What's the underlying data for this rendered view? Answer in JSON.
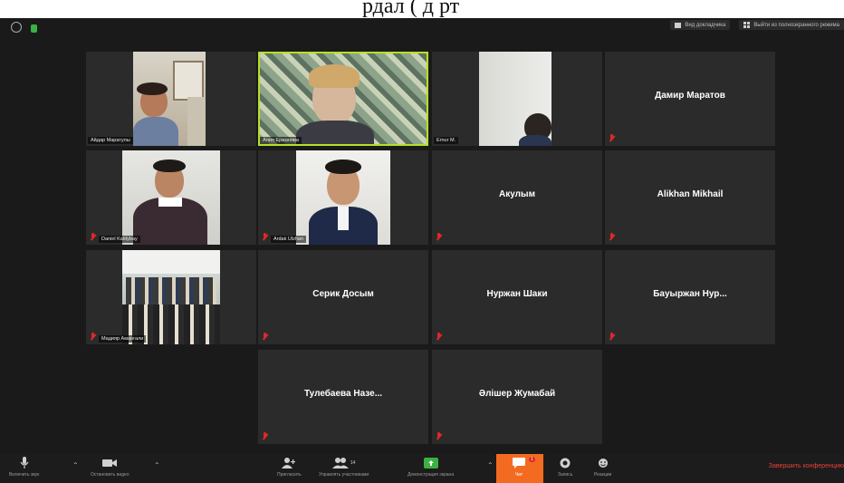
{
  "top_caption": "рдал (                 д  рт",
  "meeting": {
    "view_buttons": [
      {
        "label": "Вид докладчика"
      },
      {
        "label": "Выйти из полноэкранного режима"
      }
    ],
    "participants": [
      {
        "name": "Айдар Маратулы",
        "has_video": true
      },
      {
        "name": "Алия Ержанова",
        "has_video": true,
        "speaking": true
      },
      {
        "name": "Ernur M.",
        "has_video": true
      },
      {
        "name": "Дамир Маратов",
        "has_video": false,
        "muted": true
      },
      {
        "name": "Daniel Kaldybay",
        "has_video": true,
        "muted": true
      },
      {
        "name": "Ardak Ulzhan",
        "has_video": true,
        "muted": true
      },
      {
        "name": "Акулым",
        "has_video": false,
        "muted": true
      },
      {
        "name": "Alikhan Mikhail",
        "has_video": false,
        "muted": true
      },
      {
        "name": "Мадияр Амангали",
        "has_video": true,
        "muted": true
      },
      {
        "name": "Серик Досым",
        "has_video": false,
        "muted": true
      },
      {
        "name": "Нуржан Шаки",
        "has_video": false,
        "muted": true
      },
      {
        "name": "Бауыржан Нур...",
        "has_video": false,
        "muted": true
      },
      {
        "name": "Тулебаева Назе...",
        "has_video": false,
        "muted": true
      },
      {
        "name": "Әлішер Жумабай",
        "has_video": false,
        "muted": true
      }
    ]
  },
  "toolbar": {
    "mute_label": "Включить звук",
    "video_label": "Остановить видео",
    "invite_label": "Пригласить",
    "participants_label": "Управлять участниками",
    "participants_count": "14",
    "share_label": "Демонстрация экрана",
    "chat_label": "Чат",
    "chat_badge": "1",
    "record_label": "Запись",
    "reactions_label": "Реакции",
    "end_label": "Завершить конференцию"
  },
  "colors": {
    "speaking_border": "#b6e026",
    "chat_highlight": "#f26b21",
    "muted_icon": "#e02828"
  }
}
